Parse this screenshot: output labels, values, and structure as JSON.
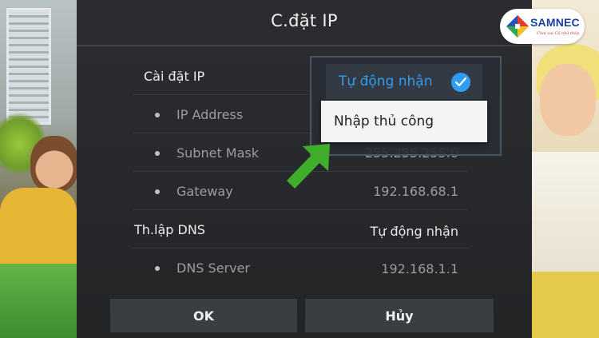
{
  "dialog": {
    "title": "C.đặt IP"
  },
  "ip_settings": {
    "label": "Cài đặt IP",
    "ip_address": {
      "label": "IP Address",
      "value": ""
    },
    "subnet_mask": {
      "label": "Subnet Mask",
      "value": "255.255.255.0"
    },
    "gateway": {
      "label": "Gateway",
      "value": "192.168.68.1"
    }
  },
  "dns": {
    "label": "Th.lập DNS",
    "mode_value": "Tự động nhận",
    "server": {
      "label": "DNS Server",
      "value": "192.168.1.1"
    }
  },
  "dropdown": {
    "options": [
      {
        "label": "Tự động nhận",
        "selected": true
      },
      {
        "label": "Nhập thủ công",
        "selected": false,
        "focused": true
      }
    ]
  },
  "buttons": {
    "ok": "OK",
    "cancel": "Hủy"
  },
  "logo": {
    "text": "SAMNEC",
    "tagline": "Chơi vui Cả nhà thép"
  },
  "colors": {
    "dialog_bg": "#2b2d30",
    "accent_blue": "#2f9df3",
    "arrow_green": "#3fae2a",
    "brand_blue": "#1d3f9c"
  }
}
